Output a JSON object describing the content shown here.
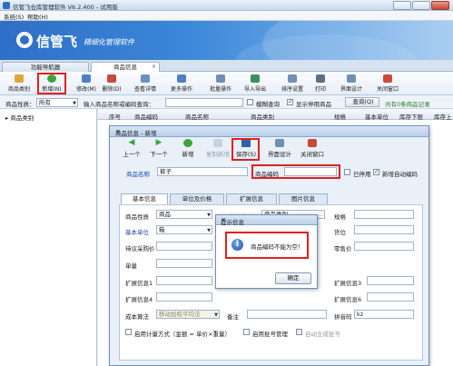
{
  "window": {
    "title": "信管飞仓库管理软件 V6.2.400 - 试用版"
  },
  "menu": {
    "items": [
      "系统(S)",
      "帮助(H)"
    ]
  },
  "banner": {
    "logo": "信管飞",
    "slogan": "精细化管理软件"
  },
  "tabs": [
    {
      "label": "功能导航器"
    },
    {
      "label": "商品信息"
    }
  ],
  "toolbar": {
    "items": [
      {
        "label": "商品类别",
        "color": "#e0a43a"
      },
      {
        "label": "新增(N)",
        "color": "#3aa53a"
      },
      {
        "label": "修改(M)",
        "color": "#4f7fc6"
      },
      {
        "label": "删除(D)",
        "color": "#c94a3a"
      },
      {
        "label": "查看详情",
        "color": "#6d8fc2"
      },
      {
        "label": "更多操作",
        "color": "#4f7fc6"
      },
      {
        "label": "批量操作",
        "color": "#6f8fb3"
      },
      {
        "label": "导入导出",
        "color": "#3f8f5a"
      },
      {
        "label": "排序设置",
        "color": "#6f8fb3"
      },
      {
        "label": "打印",
        "color": "#5c6f88"
      },
      {
        "label": "界面设计",
        "color": "#6f8fb3"
      },
      {
        "label": "关闭窗口",
        "color": "#c94a3a"
      }
    ]
  },
  "search": {
    "scope_label": "商品性质：",
    "scope_value": "所有",
    "keyword_label": "输入商品名称或编码查询：",
    "keyword_value": "",
    "fuzzy_label": "模糊查询",
    "show_disabled_label": "显示停用商品",
    "query_button": "查询(Q)",
    "summary": "共有0条商品记录"
  },
  "tree": {
    "root": "商品类别"
  },
  "grid": {
    "columns": [
      "序号",
      "商品编码",
      "商品名称",
      "商品类别",
      "规格",
      "基本单位",
      "库存下限",
      "库存上"
    ]
  },
  "dialog": {
    "title": "商品信息 - 新增",
    "toolbar": [
      {
        "label": "上一个",
        "color": "#3aa53a"
      },
      {
        "label": "下一个",
        "color": "#3aa53a"
      },
      {
        "label": "新增",
        "color": "#3aa53a"
      },
      {
        "label": "复制新增",
        "color": "#8fa3bd"
      },
      {
        "label": "保存(S)",
        "color": "#2f5fae"
      },
      {
        "label": "界面设计",
        "color": "#6f8fb3"
      },
      {
        "label": "关闭窗口",
        "color": "#c94a3a"
      }
    ],
    "name_label": "商品名称",
    "name_value": "裤子",
    "code_label": "商品编码",
    "code_value": "",
    "disabled_label": "已停用",
    "auto_code_label": "新增自动编码",
    "subtabs": [
      "基本信息",
      "单位及价格",
      "扩展信息",
      "图片信息"
    ],
    "form": {
      "nature_label": "商品性质",
      "nature_value": "商品",
      "category_label": "商品类别",
      "category_value": "商品类别",
      "spec_label": "规格",
      "unit_label": "基本单位",
      "unit_value": "箱",
      "position_label": "货位",
      "std_price_label": "待议采购价",
      "retail_label": "零售价",
      "unit_price_label": "单量",
      "ext1_label": "扩展信息1",
      "ext3_label": "扩展信息3",
      "ext4_label": "扩展信息4",
      "ext6_label": "扩展信息6",
      "cost_label": "成本算法",
      "cost_value": "移动加权平均法",
      "remark_label": "备注",
      "pinyin_label": "拼音码",
      "pinyin_value": "kz",
      "enable_label": "启用计量方式（金额 = 单价×重量）",
      "batch_label": "启用批号管理",
      "auto_batch_label": "自动生成批号"
    }
  },
  "popup": {
    "title": "提示信息",
    "message": "商品编码不能为空！",
    "ok": "确定"
  },
  "colors": {
    "highlight": "#e02020",
    "banner": "#2e6fc7"
  }
}
